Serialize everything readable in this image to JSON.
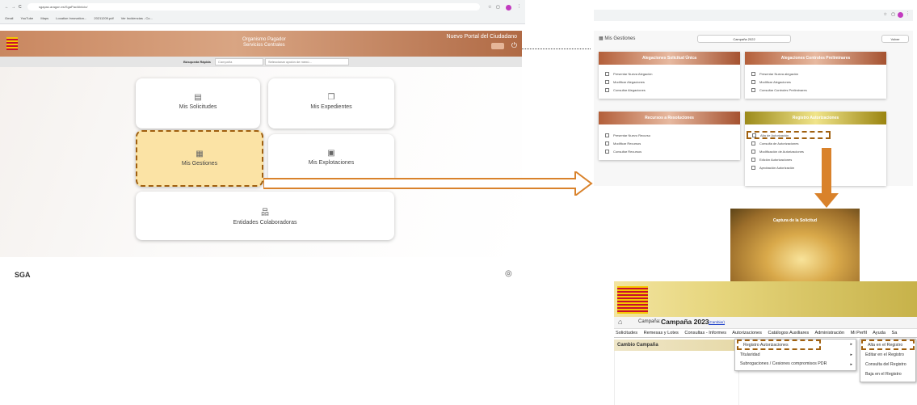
{
  "browser": {
    "url": "sgapac.aragon.es/SgaPac/#inicio/",
    "bookmarks": [
      "Gmail",
      "YouTube",
      "Maps",
      "Location Innovation...",
      "20211209.pdf",
      "Ver Incidencias - Co..."
    ]
  },
  "portal": {
    "org_line1": "Organismo Pagador",
    "org_line2": "Servicios Centrales",
    "title": "Nuevo Portal del Ciudadano",
    "search_label": "Búsqueda Rápida",
    "search_select": "Campaña",
    "search_placeholder": "Seleccionar opción de menú...",
    "cards": [
      "Mis Solicitudes",
      "Mis Expedientes",
      "Mis Gestiones",
      "Mis Explotaciones",
      "Entidades Colaboradoras"
    ],
    "footer_logo": "SGA"
  },
  "gestiones": {
    "title": "Mis Gestiones",
    "campaign_select": "Campaña 2022",
    "back_button": "Volver",
    "panels": [
      {
        "title": "Alegaciones Solicitud Única",
        "items": [
          "Presentar Nueva Alegación",
          "Modificar Alegaciones",
          "Consultar Alegaciones"
        ]
      },
      {
        "title": "Alegaciones Controles Preliminares",
        "items": [
          "Presentar Nueva alegación",
          "Modificar Alegaciones",
          "Consultar Controles Preliminares"
        ]
      },
      {
        "title": "Recursos a Resoluciones",
        "items": [
          "Presentar Nuevo Recurso",
          "Modificar Recursos",
          "Consultar Recursos"
        ]
      },
      {
        "title": "Registro Autorizaciones",
        "items": [
          "Alta de Autorización",
          "Consulta de Autorizaciones",
          "Modificación de Autorizaciones",
          "Edición Autorizaciones",
          "Aprobación Autorización"
        ]
      }
    ],
    "capture_label": "Captura de la Solicitud"
  },
  "legacy": {
    "campaign_label": "Campaña:",
    "campaign_value": "Campaña 2023",
    "change_link": "(Cambiar)",
    "menu": [
      "Solicitudes",
      "Remesas y Lotes",
      "Consultas - Informes",
      "Autorizaciones",
      "Catálogos Auxiliares",
      "Administración",
      "Mi Perfil",
      "Ayuda",
      "Sa"
    ],
    "left_panel_title": "Cambio Campaña",
    "submenu": [
      "Registro Autorizaciones",
      "Titularidad",
      "Subrogaciones / Cesiones compromisos PDR"
    ],
    "subsubmenu": [
      "Alta en el Registro",
      "Editar en el Registro",
      "Consulta del Registro",
      "Baja en el Registro"
    ]
  },
  "colors": {
    "accent_dashed": "#a0600f",
    "arrow": "#d9822b",
    "copper": "#c98760",
    "gold": "#d8c84a"
  }
}
